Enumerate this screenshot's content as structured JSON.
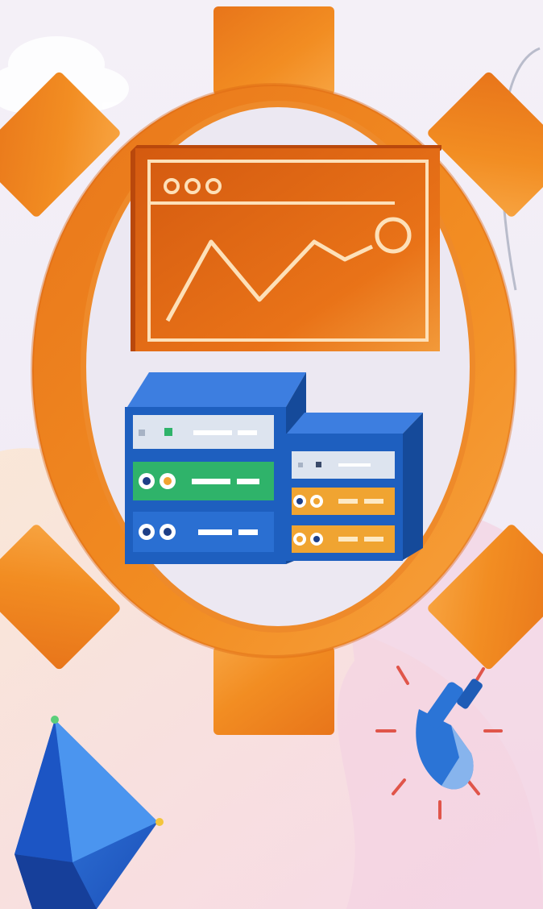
{
  "illustration": {
    "subject": "gear-with-dashboard-and-servers",
    "icons": [
      "gear-icon",
      "analytics-window-icon",
      "server-rack-icon",
      "server-rack-small-icon",
      "plug-icon",
      "pyramid-icon",
      "cloud-icon"
    ],
    "colors": {
      "background_top": "#f3eef6",
      "background_pink": "#f6d9e4",
      "background_peach": "#fbe2cf",
      "gear_orange": "#f08a1f",
      "gear_orange_dark": "#e06a12",
      "gear_inner": "#ede9f3",
      "window_orange": "#e46c13",
      "window_line": "#fde0b8",
      "server_blue": "#1e5fbf",
      "server_blue_dark": "#154a9a",
      "server_green": "#2fb36a",
      "server_light": "#dde4ef",
      "server_amber": "#f0a431",
      "plug_blue": "#2b74d6",
      "spark_red": "#e0554a",
      "pyramid_blue": "#2463d1"
    }
  }
}
